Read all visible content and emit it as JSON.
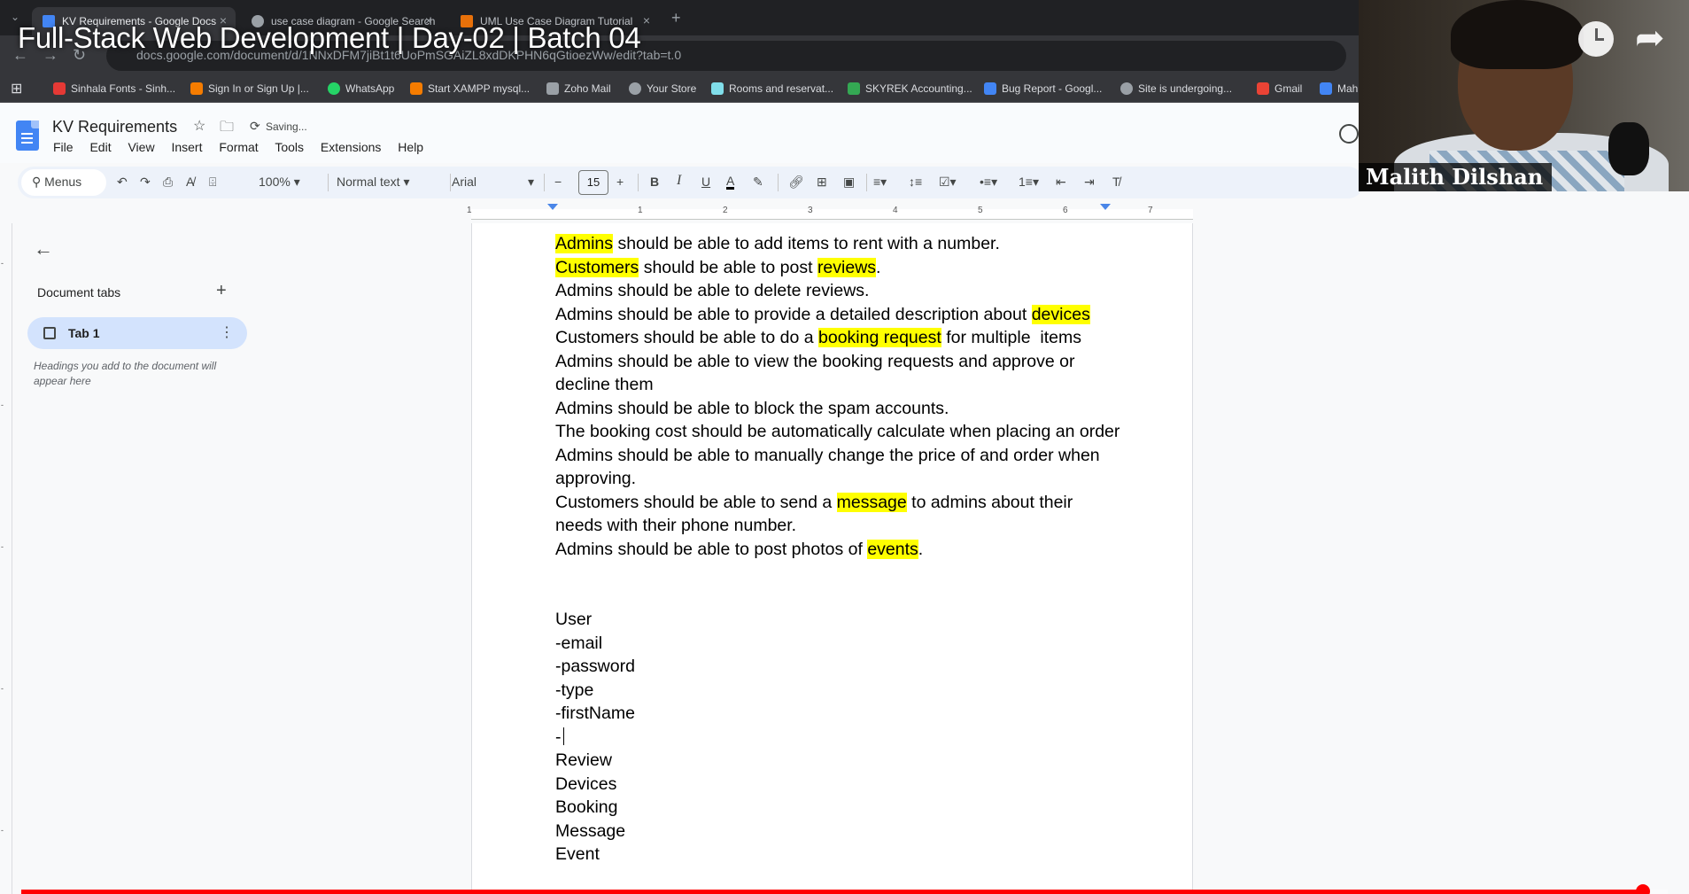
{
  "browser": {
    "tabs": [
      {
        "title": "KV Requirements - Google Docs",
        "active": true,
        "favicon_color": "#4285f4"
      },
      {
        "title": "use case diagram - Google Search",
        "active": false,
        "favicon_color": "#9aa0a6"
      },
      {
        "title": "UML Use Case Diagram Tutorial",
        "active": false,
        "favicon_color": "#e8710a"
      }
    ],
    "url": "docs.google.com/document/d/1NNxDFM7jiBt1t6UoPmSGAiZL8xdDKPHN6qGtioezWw/edit?tab=t.0",
    "bookmarks": [
      {
        "label": "Sinhala Fonts - Sinh...",
        "color": "#e53935"
      },
      {
        "label": "Sign In or Sign Up |...",
        "color": "#f57c00"
      },
      {
        "label": "WhatsApp",
        "color": "#25d366"
      },
      {
        "label": "Start XAMPP mysql...",
        "color": "#f57c00"
      },
      {
        "label": "Zoho Mail",
        "color": "#9aa0a6"
      },
      {
        "label": "Your Store",
        "color": "#9aa0a6"
      },
      {
        "label": "Rooms and reservat...",
        "color": "#80deea"
      },
      {
        "label": "SKYREK Accounting...",
        "color": "#34a853"
      },
      {
        "label": "Bug Report - Googl...",
        "color": "#4285f4"
      },
      {
        "label": "Site is undergoing...",
        "color": "#9aa0a6"
      },
      {
        "label": "Gmail",
        "color": "#ea4335"
      },
      {
        "label": "Mah",
        "color": "#4285f4"
      }
    ]
  },
  "video": {
    "title": "Full-Stack Web Development | Day-02 | Batch 04",
    "presenter_name": "Malith Dilshan",
    "progress_fraction": 0.985
  },
  "docs": {
    "title": "KV Requirements",
    "status": "Saving...",
    "menu": [
      "File",
      "Edit",
      "View",
      "Insert",
      "Format",
      "Tools",
      "Extensions",
      "Help"
    ],
    "toolbar": {
      "search_label": "Menus",
      "zoom": "100%",
      "style": "Normal text",
      "font": "Arial",
      "font_size": "15"
    },
    "ruler_numbers": [
      "1",
      "1",
      "2",
      "3",
      "4",
      "5",
      "6",
      "7"
    ],
    "sidebar": {
      "heading": "Document tabs",
      "tab_label": "Tab 1",
      "hint": "Headings you add to the document will appear here"
    },
    "body": {
      "requirements": [
        [
          {
            "t": "Admins",
            "hl": true
          },
          {
            "t": " should be able to add items to rent with a number."
          }
        ],
        [
          {
            "t": "Customers",
            "hl": true
          },
          {
            "t": " should be able to post "
          },
          {
            "t": "reviews",
            "hl": true
          },
          {
            "t": "."
          }
        ],
        [
          {
            "t": "Admins should be able to delete reviews."
          }
        ],
        [
          {
            "t": "Admins should be able to provide a detailed description about "
          },
          {
            "t": "devices",
            "hl": true
          }
        ],
        [
          {
            "t": "Customers should be able to do a "
          },
          {
            "t": "booking request",
            "hl": true
          },
          {
            "t": " for multiple  items"
          }
        ],
        [
          {
            "t": "Admins should be able to view the booking requests and approve or decline them"
          }
        ],
        [
          {
            "t": "Admins should be able to block the spam accounts."
          }
        ],
        [
          {
            "t": "The booking cost should be automatically calculate when placing an order"
          }
        ],
        [
          {
            "t": "Admins should be able to manually change the price of and order when approving."
          }
        ],
        [
          {
            "t": "Customers should be able to send a "
          },
          {
            "t": "message",
            "hl": true
          },
          {
            "t": " to admins about their needs with their phone number."
          }
        ],
        [
          {
            "t": "Admins should be able to post photos of "
          },
          {
            "t": "events",
            "hl": true
          },
          {
            "t": "."
          }
        ]
      ],
      "entities": [
        "User",
        "-email",
        "-password",
        "-type",
        "-firstName",
        "-",
        "Review",
        "Devices",
        "Booking",
        "Message",
        "Event"
      ]
    }
  },
  "colors": {
    "highlight": "#ffff00",
    "progress": "#ff0000",
    "active_tab_bg": "#d3e3fd"
  }
}
